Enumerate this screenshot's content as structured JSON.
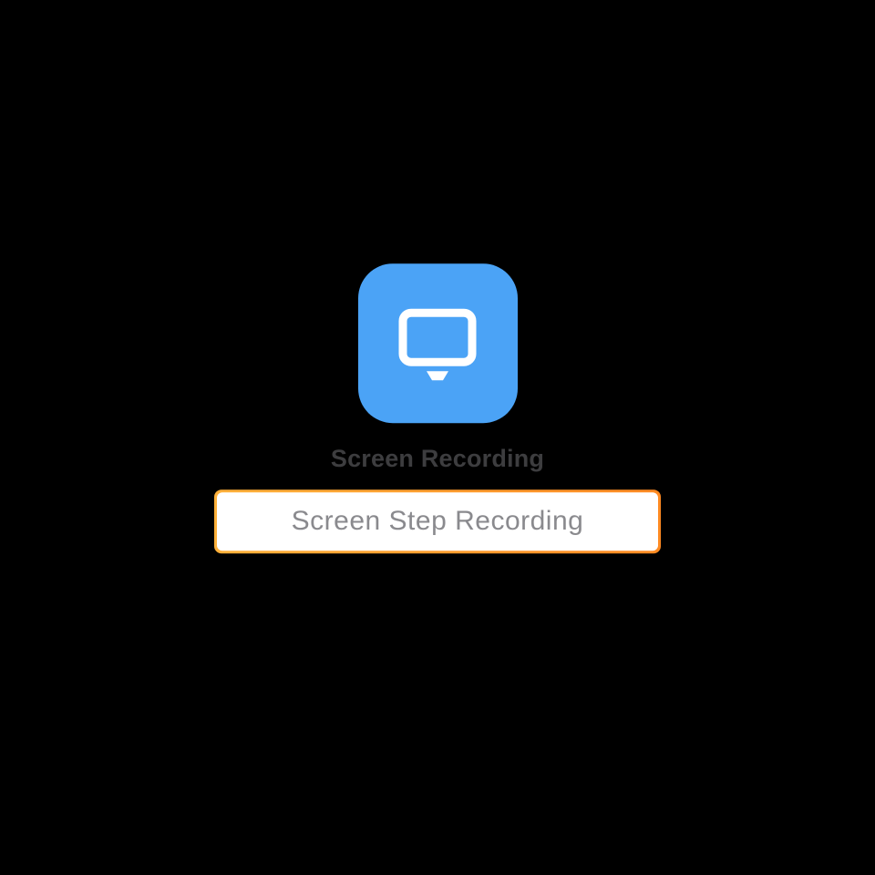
{
  "app": {
    "title": "Screen Recording",
    "icon_name": "monitor-icon",
    "icon_color": "#4ba3f6"
  },
  "button": {
    "label": "Screen Step Recording"
  }
}
